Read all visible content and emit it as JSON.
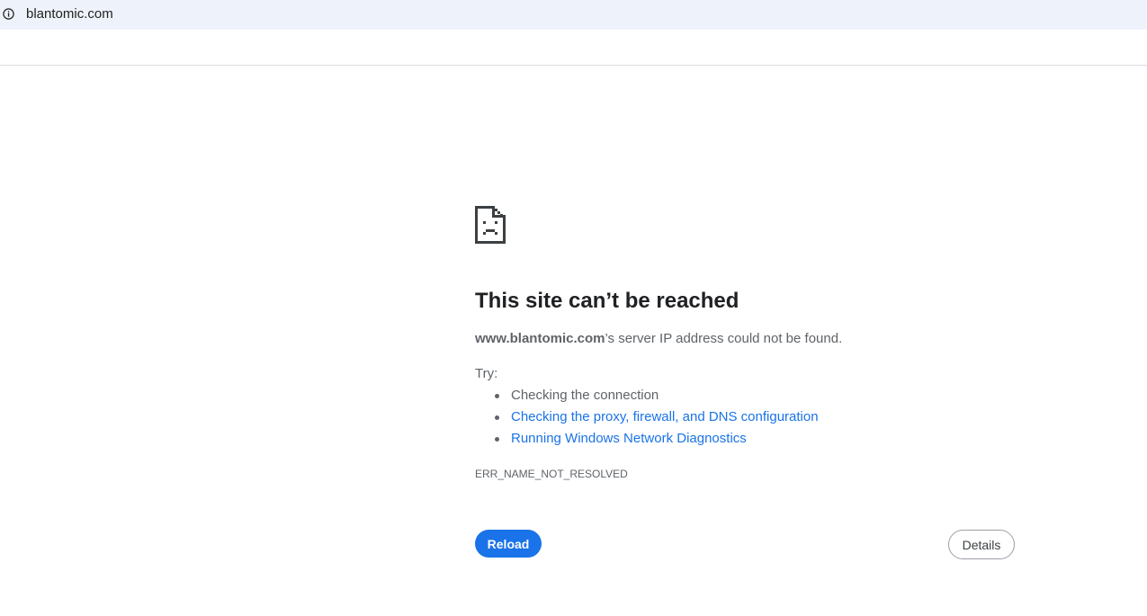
{
  "addressbar": {
    "url": "blantomic.com",
    "info_icon": "info-circle-icon"
  },
  "error_page": {
    "icon": "sad-document-icon",
    "heading": "This site can’t be reached",
    "host": "www.blantomic.com",
    "description_rest": "’s server IP address could not be found.",
    "try_label": "Try:",
    "suggestions": [
      {
        "text": "Checking the connection",
        "link": false
      },
      {
        "text": "Checking the proxy, firewall, and DNS configuration",
        "link": true
      },
      {
        "text": "Running Windows Network Diagnostics",
        "link": true
      }
    ],
    "error_code": "ERR_NAME_NOT_RESOLVED",
    "reload_label": "Reload",
    "details_label": "Details"
  },
  "colors": {
    "accent": "#1a73e8",
    "addressbar_bg": "#eef2fa",
    "secondary_text": "#5f6368"
  }
}
